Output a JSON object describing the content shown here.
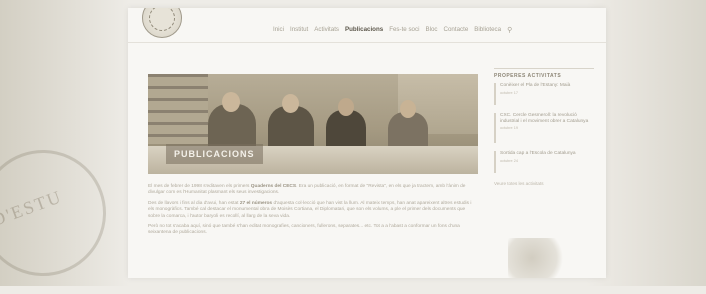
{
  "nav": {
    "items": [
      {
        "label": "Inici",
        "active": false
      },
      {
        "label": "Institut",
        "active": false
      },
      {
        "label": "Activitats",
        "active": false
      },
      {
        "label": "Publicacions",
        "active": true
      },
      {
        "label": "Fes-te soci",
        "active": false
      },
      {
        "label": "Bloc",
        "active": false
      },
      {
        "label": "Contacte",
        "active": false
      },
      {
        "label": "Biblioteca",
        "active": false
      }
    ],
    "search_icon": "search-icon"
  },
  "hero": {
    "label": "PUBLICACIONS"
  },
  "body": {
    "p1_a": "El mes de febrer de 1998 s'editaven els primers ",
    "p1_b": "Quaderns del CECS",
    "p1_c": ". Era un publicació, en format de \"Revista\", en els que ja tractem, amb l'ànim de divulgar com es l'Humanitat plasmant els seus investigacions.",
    "p2_a": "Des de llavors i fins al dia d'avui, han estat ",
    "p2_b": "27 el números",
    "p2_c": " d'aquesta col·lecció que han vist la llum. Al mateix temps, han anat apareixent altres estudis i els monogràfics. També cal destacar el monumental obra de Moisès Cortiana, el Diplomatari, que son els volums, a ple el primer dels documents que sobre la comarca, i l'autor baryoli es recollí, al llarg de la seva vida.",
    "p3": "Però no tot s'acaba aquí, sinó que també s'han editat monografies, cancioners, fullerons, separates... etc. Tot a a l'abast a conformar un fons d'una seixantena de publicacions."
  },
  "sidebar": {
    "title": "PROPERES ACTIVITATS",
    "items": [
      {
        "title": "Conèixer el Pla de l'Estany: Maià",
        "date": "octubre 17"
      },
      {
        "title": "CXC. Cercle Gesmeroll: la revolució industrial i el moviment obrer a Catalunya",
        "date": "octubre 19"
      },
      {
        "title": "Sortida cap a l'Escola de Catalunya",
        "date": "octubre 24"
      }
    ],
    "more": "Veure totes les activitats"
  },
  "background": {
    "stamp_text": "D'ESTU"
  }
}
